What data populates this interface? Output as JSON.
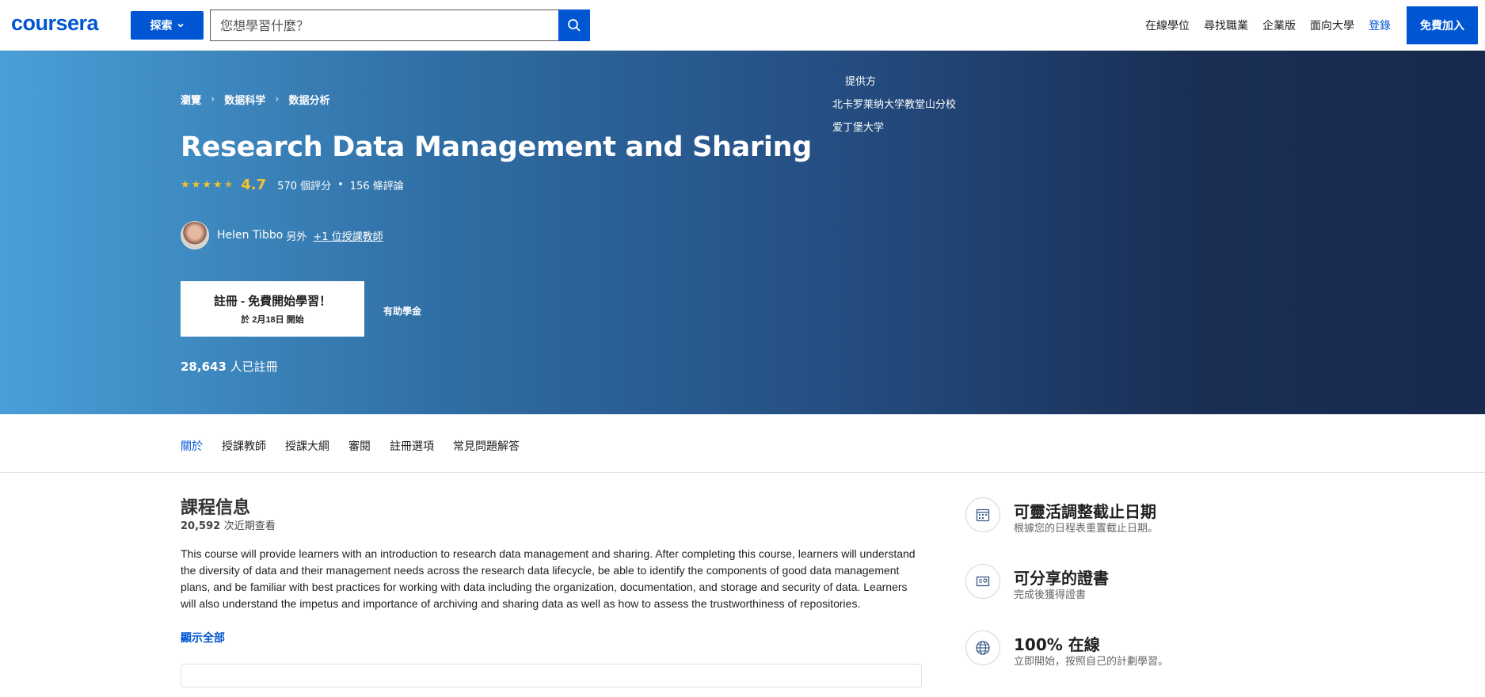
{
  "header": {
    "logo": "coursera",
    "explore_label": "探索",
    "search_placeholder": "您想學習什麼？",
    "nav": [
      "在線學位",
      "尋找職業",
      "企業版",
      "面向大學"
    ],
    "login": "登錄",
    "join": "免費加入"
  },
  "breadcrumb": [
    "瀏覽",
    "数据科学",
    "数据分析"
  ],
  "course": {
    "title": "Research Data Management and Sharing",
    "rating": "4.7",
    "rating_count": "570 個評分",
    "review_count": "156 條評論",
    "instructor": "Helen Tibbo",
    "instructor_also": "另外",
    "instructor_more": "+1 位授課教師",
    "enroll_main": "註冊 - 免費開始學習！",
    "enroll_sub": "於 2月18日 開始",
    "financial_aid": "有助學金",
    "enrolled_count": "28,643",
    "enrolled_suffix": "人已註冊"
  },
  "offered_by": {
    "label": "提供方",
    "items": [
      "北卡罗莱纳大学教堂山分校",
      "爱丁堡大学"
    ]
  },
  "tabs": [
    "關於",
    "授課教師",
    "授課大綱",
    "審閱",
    "註冊選項",
    "常見問題解答"
  ],
  "info": {
    "title": "課程信息",
    "views_count": "20,592",
    "views_suffix": "次近期查看",
    "description": "This course will provide learners with an introduction to research data management and sharing. After completing this course, learners will understand the diversity of data and their management needs across the research data lifecycle, be able to identify the components of good data management plans, and be familiar with best practices for working with data including the organization, documentation, and storage and security of data. Learners will also understand the impetus and importance of archiving and sharing data as well as how to assess the trustworthiness of repositories.",
    "show_all": "顯示全部"
  },
  "features": [
    {
      "title": "可靈活調整截止日期",
      "sub": "根據您的日程表重置截止日期。",
      "icon": "calendar-icon"
    },
    {
      "title": "可分享的證書",
      "sub": "完成後獲得證書",
      "icon": "certificate-icon"
    },
    {
      "title": "100% 在線",
      "sub": "立即開始，按照自己的計劃學習。",
      "icon": "globe-icon"
    }
  ],
  "colors": {
    "brand": "#0056d2",
    "rating": "#f5c32c"
  }
}
